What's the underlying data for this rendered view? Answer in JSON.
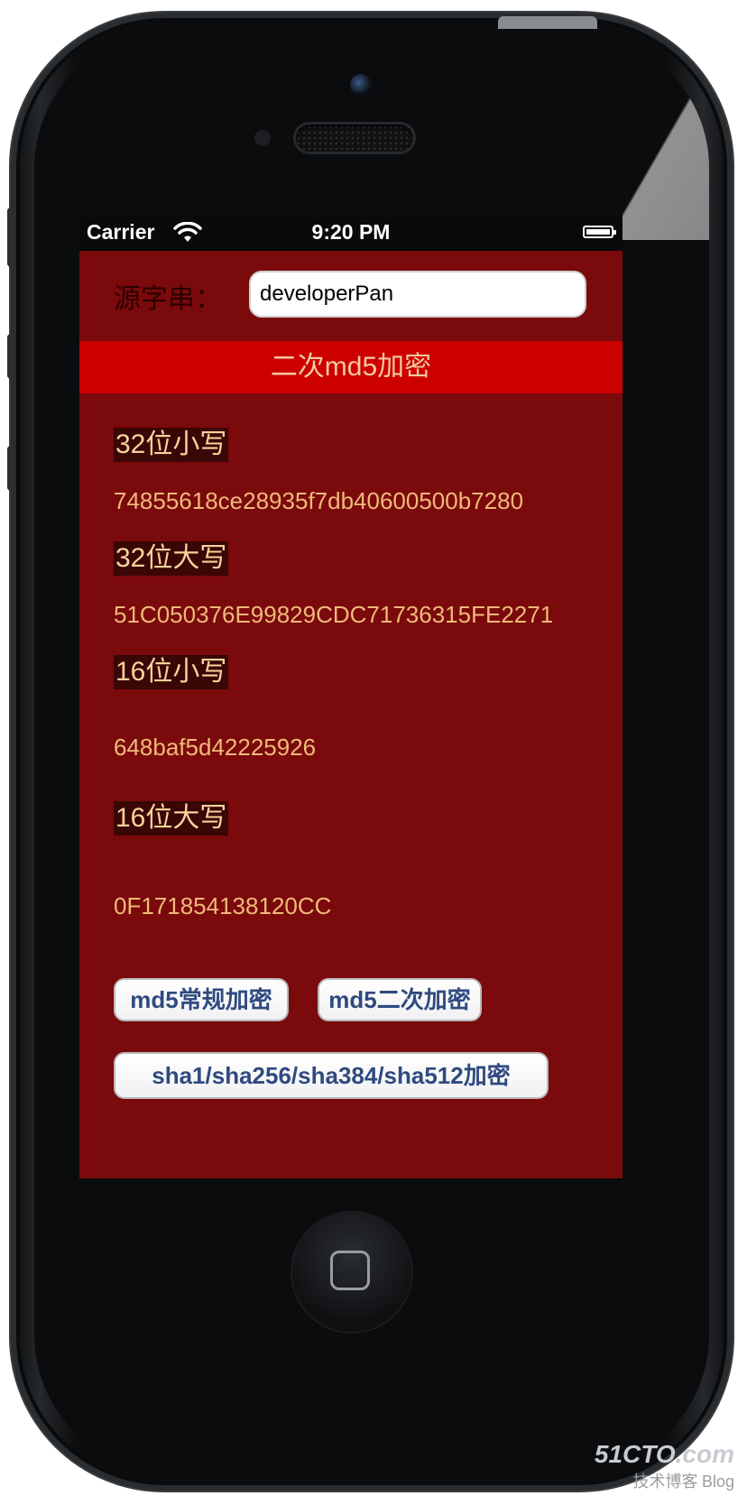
{
  "status_bar": {
    "carrier": "Carrier",
    "time": "9:20 PM"
  },
  "source": {
    "label": "源字串：",
    "value": "developerPan"
  },
  "banner": {
    "title": "二次md5加密"
  },
  "results": [
    {
      "label": "32位小写",
      "value": "74855618ce28935f7db40600500b7280"
    },
    {
      "label": "32位大写",
      "value": "51C050376E99829CDC71736315FE2271"
    },
    {
      "label": "16位小写",
      "value": "648baf5d42225926"
    },
    {
      "label": "16位大写",
      "value": "0F171854138120CC"
    }
  ],
  "buttons": {
    "md5_normal": "md5常规加密",
    "md5_double": "md5二次加密",
    "sha": "sha1/sha256/sha384/sha512加密"
  },
  "watermark": {
    "site": "51CTO.com",
    "sub": "技术博客",
    "blog": "Blog"
  },
  "colors": {
    "screen_bg": "#7a0a0b",
    "banner_bg": "#cd0000",
    "label_bg": "#3a0606",
    "hash_text": "#f0b97a",
    "button_text": "#2f4a80"
  }
}
